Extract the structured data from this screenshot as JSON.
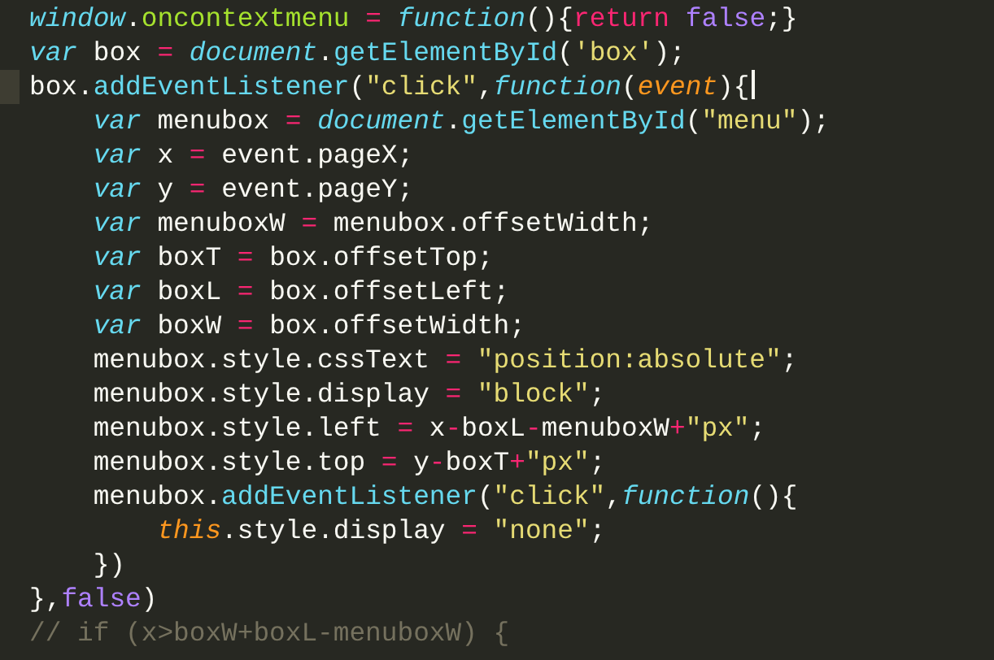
{
  "editor": {
    "lines": [
      {
        "current": false,
        "tokens": [
          {
            "kind": "builtin",
            "text": "window"
          },
          {
            "kind": "plain",
            "text": "."
          },
          {
            "kind": "property",
            "text": "oncontextmenu"
          },
          {
            "kind": "operator",
            "text": " = "
          },
          {
            "kind": "storage",
            "text": "function"
          },
          {
            "kind": "plain",
            "text": "(){"
          },
          {
            "kind": "operator",
            "text": "return"
          },
          {
            "kind": "constant",
            "text": " false"
          },
          {
            "kind": "plain",
            "text": ";}"
          }
        ]
      },
      {
        "current": false,
        "tokens": [
          {
            "kind": "storage",
            "text": "var"
          },
          {
            "kind": "plain",
            "text": " box"
          },
          {
            "kind": "operator",
            "text": " = "
          },
          {
            "kind": "builtin",
            "text": "document"
          },
          {
            "kind": "plain",
            "text": "."
          },
          {
            "kind": "function",
            "text": "getElementById"
          },
          {
            "kind": "plain",
            "text": "("
          },
          {
            "kind": "string",
            "text": "'box'"
          },
          {
            "kind": "plain",
            "text": ");"
          }
        ]
      },
      {
        "current": true,
        "tokens": [
          {
            "kind": "plain",
            "text": "box."
          },
          {
            "kind": "function",
            "text": "addEventListener"
          },
          {
            "kind": "plain",
            "text": "("
          },
          {
            "kind": "string",
            "text": "\"click\""
          },
          {
            "kind": "plain",
            "text": ","
          },
          {
            "kind": "storage",
            "text": "function"
          },
          {
            "kind": "plain",
            "text": "("
          },
          {
            "kind": "parameter",
            "text": "event"
          },
          {
            "kind": "plain",
            "text": "){"
          }
        ]
      },
      {
        "current": false,
        "tokens": [
          {
            "kind": "storage",
            "text": "    var"
          },
          {
            "kind": "plain",
            "text": " menubox"
          },
          {
            "kind": "operator",
            "text": " = "
          },
          {
            "kind": "builtin",
            "text": "document"
          },
          {
            "kind": "plain",
            "text": "."
          },
          {
            "kind": "function",
            "text": "getElementById"
          },
          {
            "kind": "plain",
            "text": "("
          },
          {
            "kind": "string",
            "text": "\"menu\""
          },
          {
            "kind": "plain",
            "text": ");"
          }
        ]
      },
      {
        "current": false,
        "tokens": [
          {
            "kind": "storage",
            "text": "    var"
          },
          {
            "kind": "plain",
            "text": " x"
          },
          {
            "kind": "operator",
            "text": " = "
          },
          {
            "kind": "plain",
            "text": "event.pageX;"
          }
        ]
      },
      {
        "current": false,
        "tokens": [
          {
            "kind": "storage",
            "text": "    var"
          },
          {
            "kind": "plain",
            "text": " y"
          },
          {
            "kind": "operator",
            "text": " = "
          },
          {
            "kind": "plain",
            "text": "event.pageY;"
          }
        ]
      },
      {
        "current": false,
        "tokens": [
          {
            "kind": "storage",
            "text": "    var"
          },
          {
            "kind": "plain",
            "text": " menuboxW"
          },
          {
            "kind": "operator",
            "text": " = "
          },
          {
            "kind": "plain",
            "text": "menubox.offsetWidth;"
          }
        ]
      },
      {
        "current": false,
        "tokens": [
          {
            "kind": "storage",
            "text": "    var"
          },
          {
            "kind": "plain",
            "text": " boxT"
          },
          {
            "kind": "operator",
            "text": " = "
          },
          {
            "kind": "plain",
            "text": "box.offsetTop;"
          }
        ]
      },
      {
        "current": false,
        "tokens": [
          {
            "kind": "storage",
            "text": "    var"
          },
          {
            "kind": "plain",
            "text": " boxL"
          },
          {
            "kind": "operator",
            "text": " = "
          },
          {
            "kind": "plain",
            "text": "box.offsetLeft;"
          }
        ]
      },
      {
        "current": false,
        "tokens": [
          {
            "kind": "storage",
            "text": "    var"
          },
          {
            "kind": "plain",
            "text": " boxW"
          },
          {
            "kind": "operator",
            "text": " = "
          },
          {
            "kind": "plain",
            "text": "box.offsetWidth;"
          }
        ]
      },
      {
        "current": false,
        "tokens": [
          {
            "kind": "plain",
            "text": "    menubox.style.cssText"
          },
          {
            "kind": "operator",
            "text": " = "
          },
          {
            "kind": "string",
            "text": "\"position:absolute\""
          },
          {
            "kind": "plain",
            "text": ";"
          }
        ]
      },
      {
        "current": false,
        "tokens": [
          {
            "kind": "plain",
            "text": "    menubox.style.display"
          },
          {
            "kind": "operator",
            "text": " = "
          },
          {
            "kind": "string",
            "text": "\"block\""
          },
          {
            "kind": "plain",
            "text": ";"
          }
        ]
      },
      {
        "current": false,
        "tokens": [
          {
            "kind": "plain",
            "text": "    menubox.style.left"
          },
          {
            "kind": "operator",
            "text": " = "
          },
          {
            "kind": "plain",
            "text": "x"
          },
          {
            "kind": "operator",
            "text": "-"
          },
          {
            "kind": "plain",
            "text": "boxL"
          },
          {
            "kind": "operator",
            "text": "-"
          },
          {
            "kind": "plain",
            "text": "menuboxW"
          },
          {
            "kind": "operator",
            "text": "+"
          },
          {
            "kind": "string",
            "text": "\"px\""
          },
          {
            "kind": "plain",
            "text": ";"
          }
        ]
      },
      {
        "current": false,
        "tokens": [
          {
            "kind": "plain",
            "text": "    menubox.style.top"
          },
          {
            "kind": "operator",
            "text": " = "
          },
          {
            "kind": "plain",
            "text": "y"
          },
          {
            "kind": "operator",
            "text": "-"
          },
          {
            "kind": "plain",
            "text": "boxT"
          },
          {
            "kind": "operator",
            "text": "+"
          },
          {
            "kind": "string",
            "text": "\"px\""
          },
          {
            "kind": "plain",
            "text": ";"
          }
        ]
      },
      {
        "current": false,
        "tokens": [
          {
            "kind": "plain",
            "text": "    menubox."
          },
          {
            "kind": "function",
            "text": "addEventListener"
          },
          {
            "kind": "plain",
            "text": "("
          },
          {
            "kind": "string",
            "text": "\"click\""
          },
          {
            "kind": "plain",
            "text": ","
          },
          {
            "kind": "storage",
            "text": "function"
          },
          {
            "kind": "plain",
            "text": "(){"
          }
        ]
      },
      {
        "current": false,
        "tokens": [
          {
            "kind": "parameter",
            "text": "        this"
          },
          {
            "kind": "plain",
            "text": ".style.display"
          },
          {
            "kind": "operator",
            "text": " = "
          },
          {
            "kind": "string",
            "text": "\"none\""
          },
          {
            "kind": "plain",
            "text": ";"
          }
        ]
      },
      {
        "current": false,
        "tokens": [
          {
            "kind": "plain",
            "text": "    })"
          }
        ]
      },
      {
        "current": false,
        "tokens": [
          {
            "kind": "plain",
            "text": "},"
          },
          {
            "kind": "constant",
            "text": "false"
          },
          {
            "kind": "plain",
            "text": ")"
          }
        ]
      },
      {
        "current": false,
        "tokens": [
          {
            "kind": "comment",
            "text": "// if (x>boxW+boxL-menuboxW) {"
          }
        ]
      }
    ]
  }
}
